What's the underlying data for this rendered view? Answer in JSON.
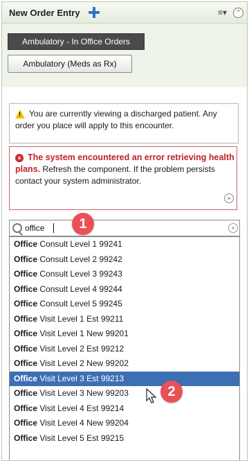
{
  "header": {
    "title": "New Order Entry",
    "add_icon": "plus-icon",
    "menu_icon": "≡▾",
    "collapse_icon": "chevron-up-circle-icon"
  },
  "tabs": [
    {
      "label": "Ambulatory - In Office Orders",
      "active": true
    },
    {
      "label": "Ambulatory (Meds as Rx)",
      "active": false
    }
  ],
  "warning": {
    "icon": "warning-triangle-icon",
    "text": "You are currently viewing a discharged patient. Any order you place will apply to this encounter."
  },
  "error": {
    "icon": "error-x-circle-icon",
    "title": "The system encountered an error retrieving health plans.",
    "body": " Refresh the component. If the problem persists contact your system administrator.",
    "close_icon": "close-circle-icon"
  },
  "search": {
    "value": "office",
    "icon": "search-icon",
    "clear_icon": "clear-circle-icon"
  },
  "results": [
    {
      "match": "Office",
      "rest": " Consult Level 1 99241"
    },
    {
      "match": "Office",
      "rest": " Consult Level 2 99242"
    },
    {
      "match": "Office",
      "rest": " Consult Level 3 99243"
    },
    {
      "match": "Office",
      "rest": " Consult Level 4 99244"
    },
    {
      "match": "Office",
      "rest": " Consult Level 5 99245"
    },
    {
      "match": "Office",
      "rest": " Visit Level 1 Est 99211"
    },
    {
      "match": "Office",
      "rest": " Visit Level 1 New 99201"
    },
    {
      "match": "Office",
      "rest": " Visit Level 2 Est 99212"
    },
    {
      "match": "Office",
      "rest": " Visit Level 2 New 99202"
    },
    {
      "match": "Office",
      "rest": " Visit Level 3 Est 99213"
    },
    {
      "match": "Office",
      "rest": " Visit Level 3 New 99203"
    },
    {
      "match": "Office",
      "rest": " Visit Level 4 Est 99214"
    },
    {
      "match": "Office",
      "rest": " Visit Level 4 New 99204"
    },
    {
      "match": "Office",
      "rest": " Visit Level 5 Est 99215"
    }
  ],
  "selected_result": 9,
  "callouts": [
    "1",
    "2"
  ],
  "colors": {
    "accent": "#2f74c7",
    "selection": "#3d6fb5",
    "error": "#c0212c",
    "callout": "#ea5056",
    "tab_active": "#4a4a4a",
    "tab_area": "#eef4e9"
  }
}
